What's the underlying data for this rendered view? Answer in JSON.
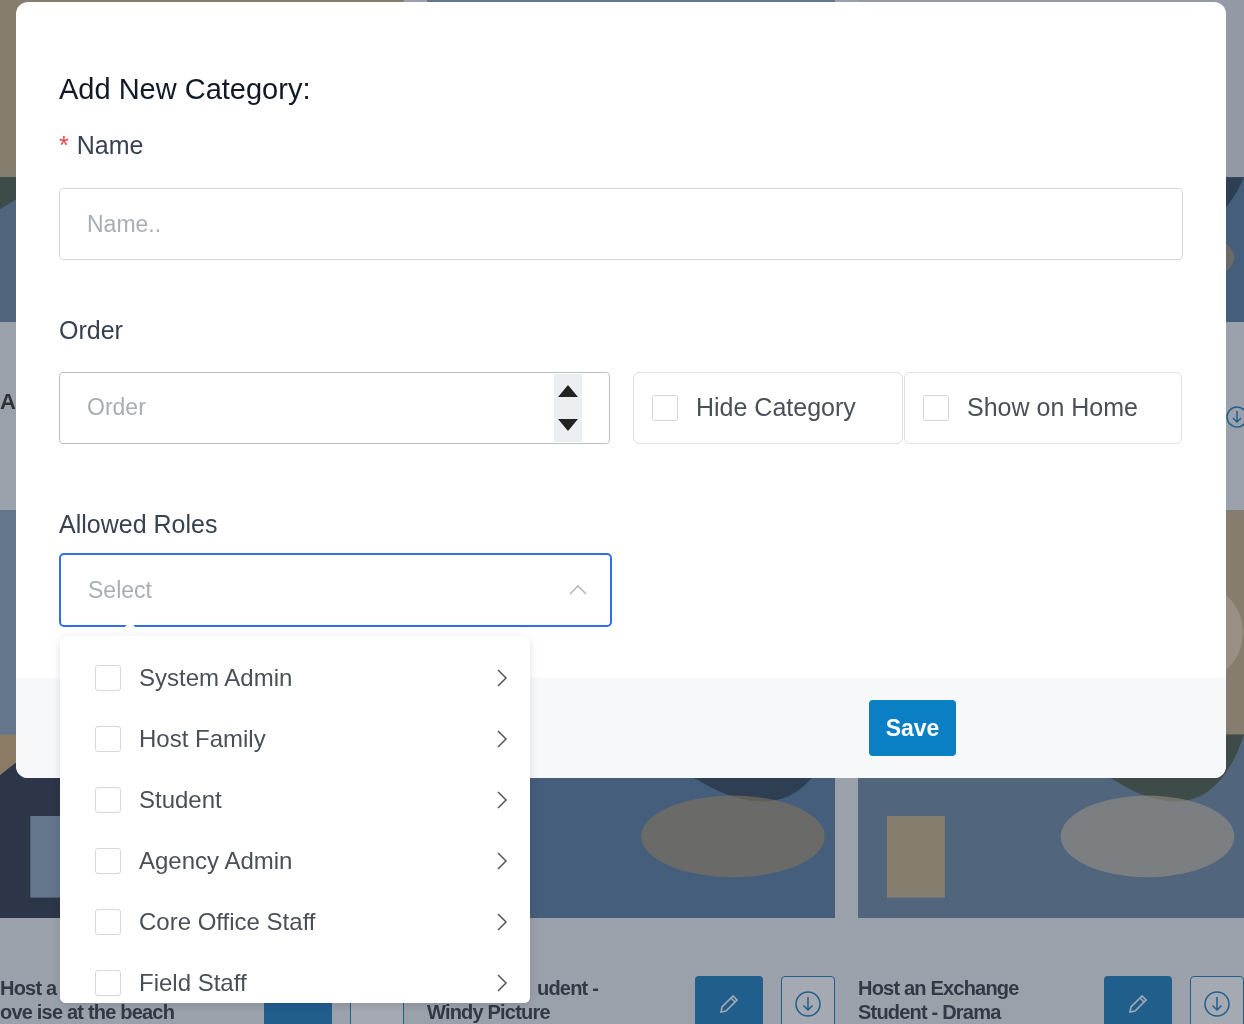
{
  "background": {
    "side_text": "A",
    "cards": [
      {
        "title_lines": [
          "Host a",
          "ove ise at the beach"
        ]
      },
      {
        "title_lines": [
          "udent -",
          "Windy Picture"
        ]
      },
      {
        "title_lines": [
          "Host an Exchange",
          "Student - Drama"
        ]
      }
    ]
  },
  "dialog": {
    "title": "Add New Category:",
    "name_field": {
      "required_mark": "*",
      "label": "Name",
      "placeholder": "Name.."
    },
    "order_field": {
      "label": "Order",
      "placeholder": "Order"
    },
    "options": [
      {
        "label": "Hide Category",
        "checked": false
      },
      {
        "label": "Show on Home",
        "checked": false
      }
    ],
    "roles_field": {
      "label": "Allowed Roles",
      "placeholder": "Select",
      "expanded": true
    },
    "roles_menu": [
      {
        "label": "System Admin",
        "checked": false
      },
      {
        "label": "Host Family",
        "checked": false
      },
      {
        "label": "Student",
        "checked": false
      },
      {
        "label": "Agency Admin",
        "checked": false
      },
      {
        "label": "Core Office Staff",
        "checked": false
      },
      {
        "label": "Field Staff",
        "checked": false
      }
    ],
    "save_button": "Save"
  }
}
